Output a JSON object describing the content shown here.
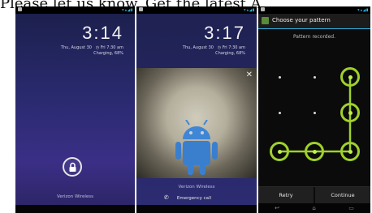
{
  "caption": "Please let us know. Get the latest A",
  "phone1": {
    "time": "3:14",
    "date": "Thu, August 30",
    "alarm": "Fri 7:30 am",
    "charging": "Charging, 68%",
    "carrier": "Verizon Wireless"
  },
  "phone2": {
    "time": "3:17",
    "date": "Thu, August 30",
    "alarm": "Fri 7:30 am",
    "charging": "Charging, 68%",
    "carrier": "Verizon Wireless",
    "emergency": "Emergency call"
  },
  "phone3": {
    "title": "Choose your pattern",
    "status": "Pattern recorded.",
    "retry": "Retry",
    "continue": "Continue"
  },
  "colors": {
    "accent": "#9fd12a",
    "holo_blue": "#33b5e5"
  }
}
